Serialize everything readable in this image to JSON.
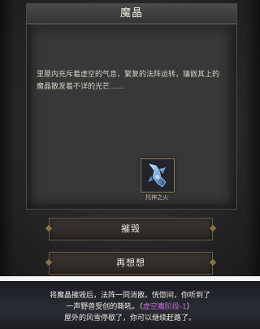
{
  "dialog": {
    "title": "魔晶",
    "description": "里屋内充斥着虚空的气息，繁复的法阵运转，镶嵌其上的魔晶散发着不详的光芒......",
    "item": {
      "icon": "crystal-claw-icon",
      "label": "托神之火"
    }
  },
  "buttons": {
    "destroy_label": "摧毁",
    "reconsider_label": "再想想"
  },
  "result_message": {
    "line1": "将魔晶摧毁后，法阵一同消散。恍惚间，你听到了",
    "line2_prefix": "一声野兽受创的嘶吼。（",
    "line2_highlight": "虚空魔阶段-1",
    "line2_suffix": "）",
    "line3": "屋外的风雪停歇了，你可以继续赶路了。"
  },
  "colors": {
    "highlight": "#c06ad8",
    "button_border": "#6a5a44"
  }
}
